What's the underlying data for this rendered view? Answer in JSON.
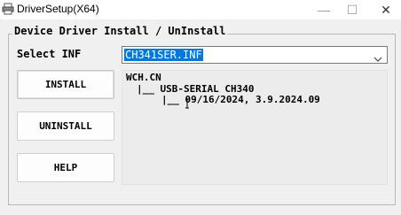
{
  "window": {
    "title": "DriverSetup(X64)",
    "icon": "printer-icon",
    "controls": {
      "minimize": "—",
      "maximize": "☐",
      "close": "✕"
    }
  },
  "group": {
    "title": "Device Driver Install / UnInstall"
  },
  "inf": {
    "label": "Select INF",
    "selected": "CH341SER.INF"
  },
  "buttons": {
    "install": "INSTALL",
    "uninstall": "UNINSTALL",
    "help": "HELP"
  },
  "info": {
    "vendor": "WCH.CN",
    "device": "|__ USB-SERIAL CH340",
    "version": "|__ 09/16/2024, 3.9.2024.09"
  },
  "colors": {
    "selection": "#0078d7",
    "window_bg": "#f0f0f0"
  }
}
